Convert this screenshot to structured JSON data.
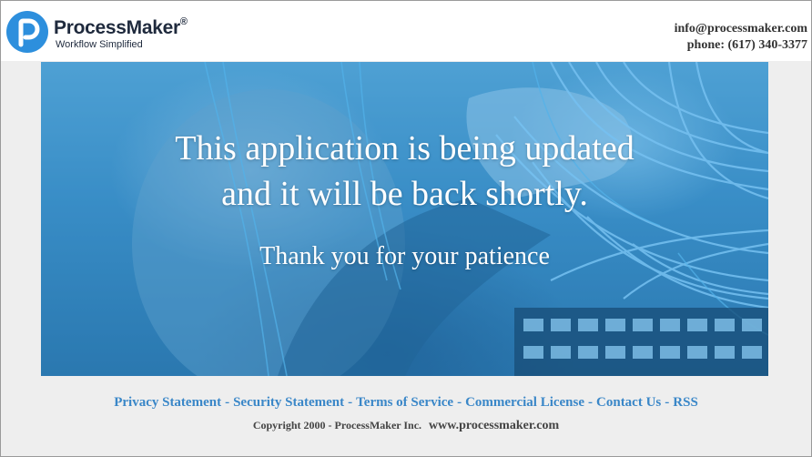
{
  "brand": {
    "name": "ProcessMaker",
    "registered": "®",
    "tagline": "Workflow Simplified",
    "logo_icon": "processmaker-p-logo-icon",
    "color": "#2d8fdd"
  },
  "contact": {
    "email": "info@processmaker.com",
    "phone": "phone: (617) 340-3377"
  },
  "hero": {
    "line1": "This application is being updated",
    "line2": "and it will be back shortly.",
    "line3": "Thank you for your patience"
  },
  "footer": {
    "links": [
      "Privacy Statement",
      "Security Statement",
      "Terms of Service",
      "Commercial License",
      "Contact Us",
      "RSS"
    ],
    "separator": "-",
    "copyright": "Copyright 2000 - ProcessMaker Inc.",
    "website": "www.processmaker.com",
    "link_color": "#3a87c8"
  }
}
